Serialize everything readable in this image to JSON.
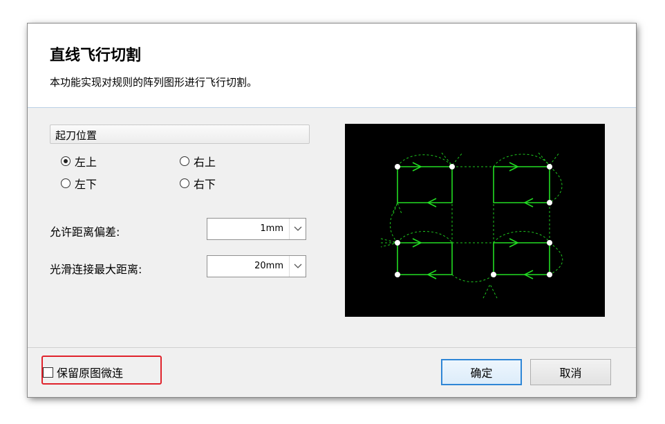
{
  "dialog": {
    "title": "直线飞行切割",
    "subtitle": "本功能实现对规则的阵列图形进行飞行切割。"
  },
  "start_position": {
    "header": "起刀位置",
    "options": [
      {
        "label": "左上",
        "checked": true
      },
      {
        "label": "右上",
        "checked": false
      },
      {
        "label": "左下",
        "checked": false
      },
      {
        "label": "右下",
        "checked": false
      }
    ]
  },
  "fields": {
    "tolerance_label": "允许距离偏差:",
    "tolerance_value": "1mm",
    "smooth_label": "光滑连接最大距离:",
    "smooth_value": "20mm"
  },
  "preview": {
    "background": "#000000",
    "cut_color": "#22dd22",
    "move_color": "#ffffff",
    "point_color": "#ffffff"
  },
  "footer": {
    "keep_microjoint_label": "保留原图微连",
    "keep_microjoint_checked": false,
    "highlight_color": "#e0222b",
    "ok_label": "确定",
    "cancel_label": "取消"
  }
}
